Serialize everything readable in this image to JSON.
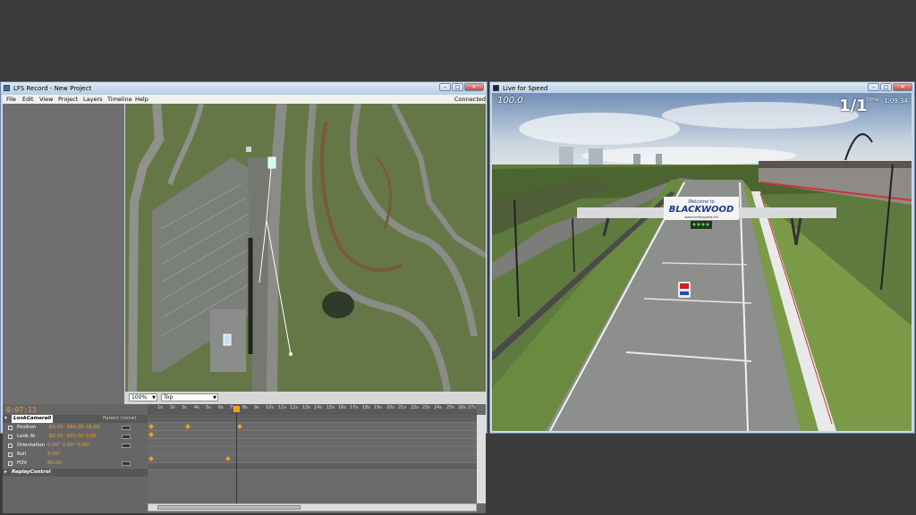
{
  "editor": {
    "title": "LFS Record - New Project",
    "menu": [
      "File",
      "Edit",
      "View",
      "Project",
      "Layers",
      "Timeline",
      "Help"
    ],
    "status": "Connected",
    "zoom": "100%",
    "view": "Top",
    "time": "0:07:13",
    "layer": "LookCamera0",
    "parent": "Parent (none)",
    "properties": [
      {
        "label": "Position",
        "value": "-83.00   -184.00   28.00"
      },
      {
        "label": "Look At",
        "value": "-82.00   -105.00   0.00"
      },
      {
        "label": "Orientation",
        "value": "0.00°   0.00°   0.00°"
      },
      {
        "label": "Roll",
        "value": "0.00°"
      },
      {
        "label": "FOV",
        "value": "80.00"
      }
    ],
    "layer2": "ReplayControl",
    "ruler": [
      "1s",
      "2s",
      "3s",
      "4s",
      "5s",
      "6s",
      "7s",
      "8s",
      "9s",
      "10s",
      "11s",
      "12s",
      "13s",
      "14s",
      "15s",
      "16s",
      "17s",
      "18s",
      "19s",
      "20s",
      "21s",
      "22s",
      "23s",
      "24s",
      "25s",
      "26s",
      "27s"
    ]
  },
  "game": {
    "title": "Live for Speed",
    "speed": "100.0",
    "position": "1/1",
    "time_label": "time",
    "time": "1:09.34",
    "banner_top": "Welcome to",
    "banner_logo": "BLACKWOOD",
    "banner_sub": "www.liveforspeed.net"
  },
  "colors": {
    "accent": "#f0a020",
    "titlebar": "#c9d9ea"
  }
}
